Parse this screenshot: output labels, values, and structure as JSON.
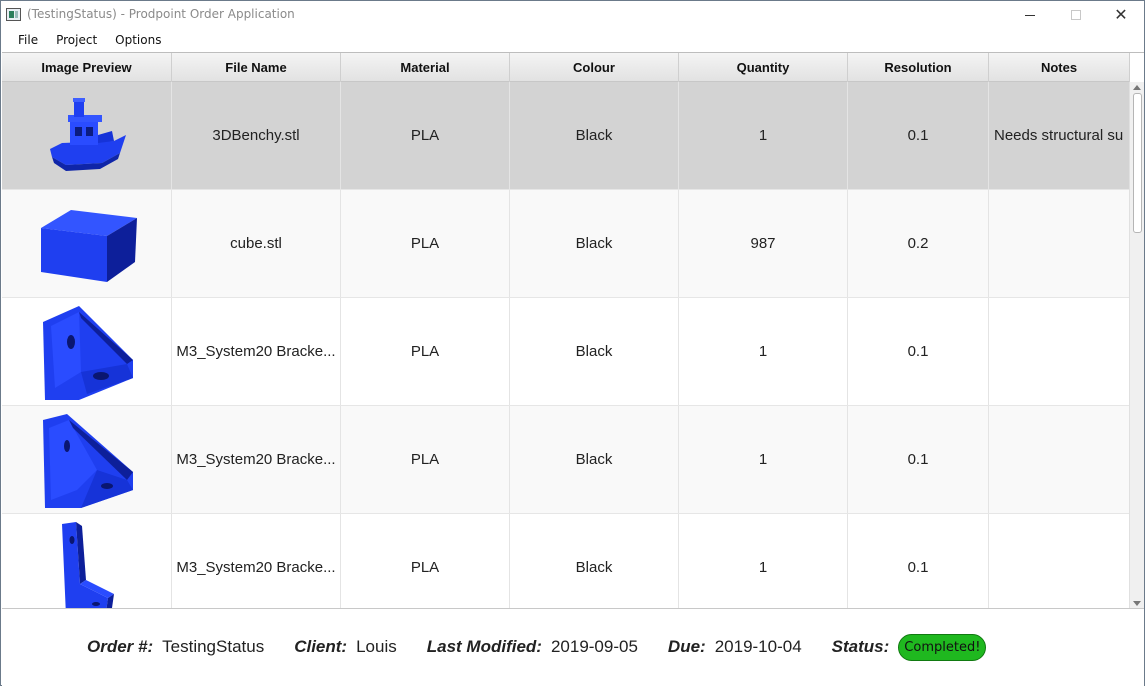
{
  "window": {
    "title": "(TestingStatus) - Prodpoint Order Application",
    "minimize": "—",
    "close": "✕"
  },
  "menu": [
    "File",
    "Project",
    "Options"
  ],
  "table": {
    "columns": [
      "Image Preview",
      "File Name",
      "Material",
      "Colour",
      "Quantity",
      "Resolution",
      "Notes"
    ],
    "rows": [
      {
        "preview_icon": "benchy-boat-model-icon",
        "file": "3DBenchy.stl",
        "material": "PLA",
        "colour": "Black",
        "quantity": "1",
        "resolution": "0.1",
        "notes": "Needs structural su"
      },
      {
        "preview_icon": "cube-model-icon",
        "file": "cube.stl",
        "material": "PLA",
        "colour": "Black",
        "quantity": "987",
        "resolution": "0.2",
        "notes": ""
      },
      {
        "preview_icon": "bracket-model-icon",
        "file": "M3_System20 Bracke...",
        "material": "PLA",
        "colour": "Black",
        "quantity": "1",
        "resolution": "0.1",
        "notes": ""
      },
      {
        "preview_icon": "bracket-model-icon",
        "file": "M3_System20 Bracke...",
        "material": "PLA",
        "colour": "Black",
        "quantity": "1",
        "resolution": "0.1",
        "notes": ""
      },
      {
        "preview_icon": "l-bracket-model-icon",
        "file": "M3_System20 Bracke...",
        "material": "PLA",
        "colour": "Black",
        "quantity": "1",
        "resolution": "0.1",
        "notes": ""
      }
    ],
    "selected_row": 0
  },
  "footer": {
    "order_label": "Order #:",
    "order_value": "TestingStatus",
    "client_label": "Client:",
    "client_value": "Louis",
    "modified_label": "Last Modified:",
    "modified_value": "2019-09-05",
    "due_label": "Due:",
    "due_value": "2019-10-04",
    "status_label": "Status:",
    "status_value": "Completed!"
  },
  "colors": {
    "model_blue": "#1f3ff0",
    "status_green": "#1fb81f",
    "selected_row": "#d3d3d3"
  }
}
